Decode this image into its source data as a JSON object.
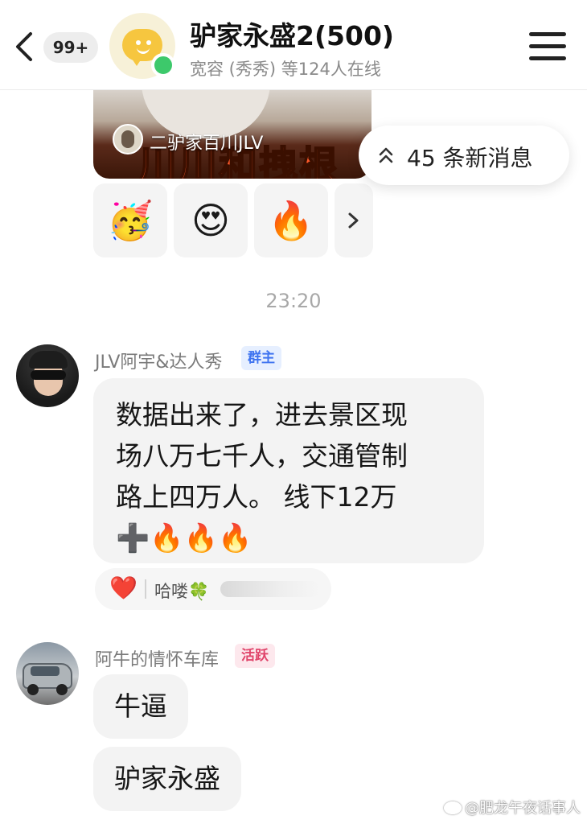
{
  "header": {
    "unread_count": "99+",
    "title": "驴家永盛2(500)",
    "subtitle": "宽容 (秀秀) 等124人在线"
  },
  "video_card": {
    "caption": "二驴家百川JLV",
    "overlay_text": "川川和拽根"
  },
  "new_messages": {
    "label": "45 条新消息"
  },
  "reactions": [
    "🥳",
    "😍",
    "🔥"
  ],
  "timestamp": "23:20",
  "messages": [
    {
      "sender": "JLV阿宇&达人秀",
      "role": "群主",
      "lines": [
        "数据出来了，进去景区现",
        "场八万七千人，交通管制",
        "路上四万人。 线下12万"
      ],
      "emoji_line": "➕🔥🔥🔥",
      "reaction": {
        "icon": "❤️",
        "user": "哈喽🍀"
      }
    },
    {
      "sender": "阿牛的情怀车库",
      "role": "活跃",
      "bubbles": [
        "牛逼",
        "驴家永盛"
      ]
    }
  ],
  "watermark": "@肥龙午夜话事人",
  "colors": {
    "online": "#3dc96b",
    "owner_badge": "#3f74f0",
    "active_badge": "#e0456b",
    "bubble_bg": "#f3f3f3"
  }
}
